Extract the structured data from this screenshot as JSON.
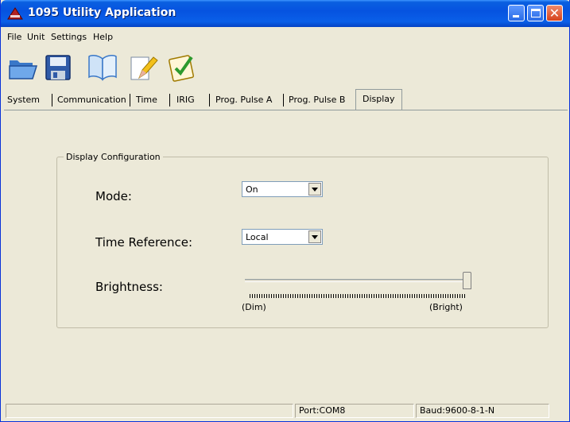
{
  "window": {
    "title": "1095 Utility Application",
    "colors": {
      "titlebar": "#0a5fe0",
      "close": "#d6421c",
      "face": "#ece9d8"
    }
  },
  "menu": [
    "File",
    "Unit",
    "Settings",
    "Help"
  ],
  "toolbar": {
    "icons": [
      "open-folder-icon",
      "save-disk-icon",
      "manual-book-icon",
      "edit-pencil-icon",
      "checklist-icon"
    ]
  },
  "tabs": [
    "System",
    "Communication",
    "Time",
    "IRIG",
    "Prog. Pulse A",
    "Prog. Pulse B",
    "Display"
  ],
  "active_tab": "Display",
  "display": {
    "group_title": "Display Configuration",
    "mode": {
      "label": "Mode:",
      "value": "On"
    },
    "time_reference": {
      "label": "Time Reference:",
      "value": "Local"
    },
    "brightness": {
      "label": "Brightness:",
      "min_label": "(Dim)",
      "max_label": "(Bright)",
      "level": 1.0
    }
  },
  "status": {
    "port": "Port:COM8",
    "baud": "Baud:9600-8-1-N"
  }
}
